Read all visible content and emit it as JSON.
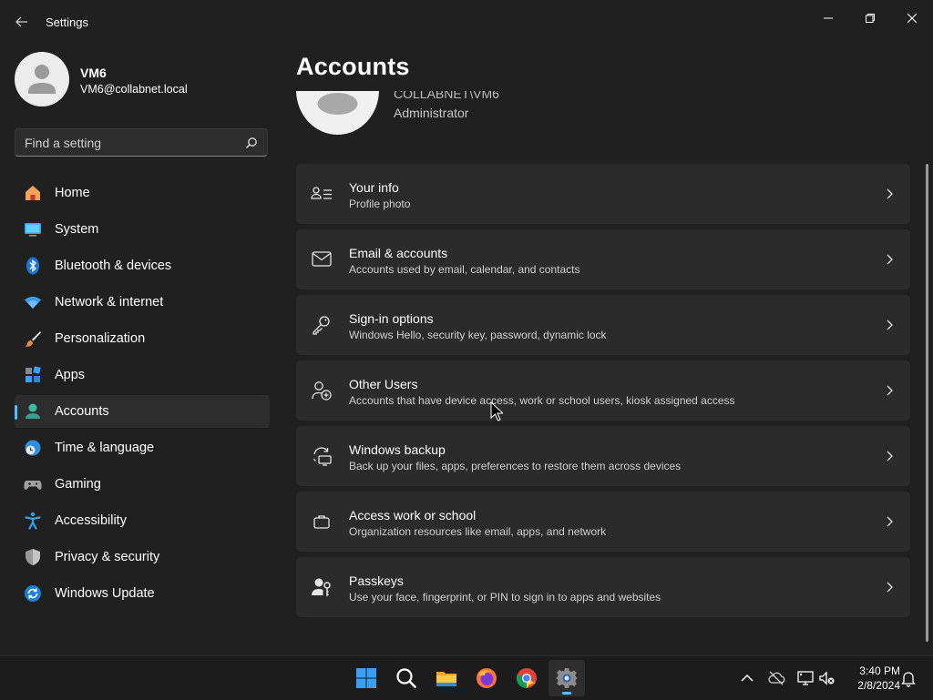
{
  "window": {
    "title": "Settings"
  },
  "profile": {
    "name": "VM6",
    "email": "VM6@collabnet.local"
  },
  "search": {
    "placeholder": "Find a setting"
  },
  "nav": [
    {
      "label": "Home",
      "icon": "home-icon"
    },
    {
      "label": "System",
      "icon": "monitor-icon"
    },
    {
      "label": "Bluetooth & devices",
      "icon": "bluetooth-icon"
    },
    {
      "label": "Network & internet",
      "icon": "wifi-icon"
    },
    {
      "label": "Personalization",
      "icon": "brush-icon"
    },
    {
      "label": "Apps",
      "icon": "apps-icon"
    },
    {
      "label": "Accounts",
      "icon": "accounts-icon",
      "selected": true
    },
    {
      "label": "Time & language",
      "icon": "clock-globe-icon"
    },
    {
      "label": "Gaming",
      "icon": "gamepad-icon"
    },
    {
      "label": "Accessibility",
      "icon": "accessibility-icon"
    },
    {
      "label": "Privacy & security",
      "icon": "shield-icon"
    },
    {
      "label": "Windows Update",
      "icon": "update-icon"
    }
  ],
  "page": {
    "title": "Accounts",
    "account_line": "COLLABNET\\VM6",
    "account_role": "Administrator"
  },
  "cards": [
    {
      "title": "Your info",
      "desc": "Profile photo",
      "icon": "person-card-icon"
    },
    {
      "title": "Email & accounts",
      "desc": "Accounts used by email, calendar, and contacts",
      "icon": "mail-icon"
    },
    {
      "title": "Sign-in options",
      "desc": "Windows Hello, security key, password, dynamic lock",
      "icon": "key-icon"
    },
    {
      "title": "Other Users",
      "desc": "Accounts that have device access, work or school users, kiosk assigned access",
      "icon": "person-add-icon"
    },
    {
      "title": "Windows backup",
      "desc": "Back up your files, apps, preferences to restore them across devices",
      "icon": "backup-icon"
    },
    {
      "title": "Access work or school",
      "desc": "Organization resources like email, apps, and network",
      "icon": "briefcase-icon"
    },
    {
      "title": "Passkeys",
      "desc": "Use your face, fingerprint, or PIN to sign in to apps and websites",
      "icon": "passkey-icon"
    }
  ],
  "taskbar": {
    "apps": [
      "start-icon",
      "search-icon",
      "file-explorer-icon",
      "firefox-icon",
      "chrome-icon",
      "settings-icon"
    ],
    "time": "3:40 PM",
    "date": "2/8/2024"
  },
  "colors": {
    "accent": "#4cc2ff",
    "background": "#202020",
    "card": "#2b2b2b"
  }
}
